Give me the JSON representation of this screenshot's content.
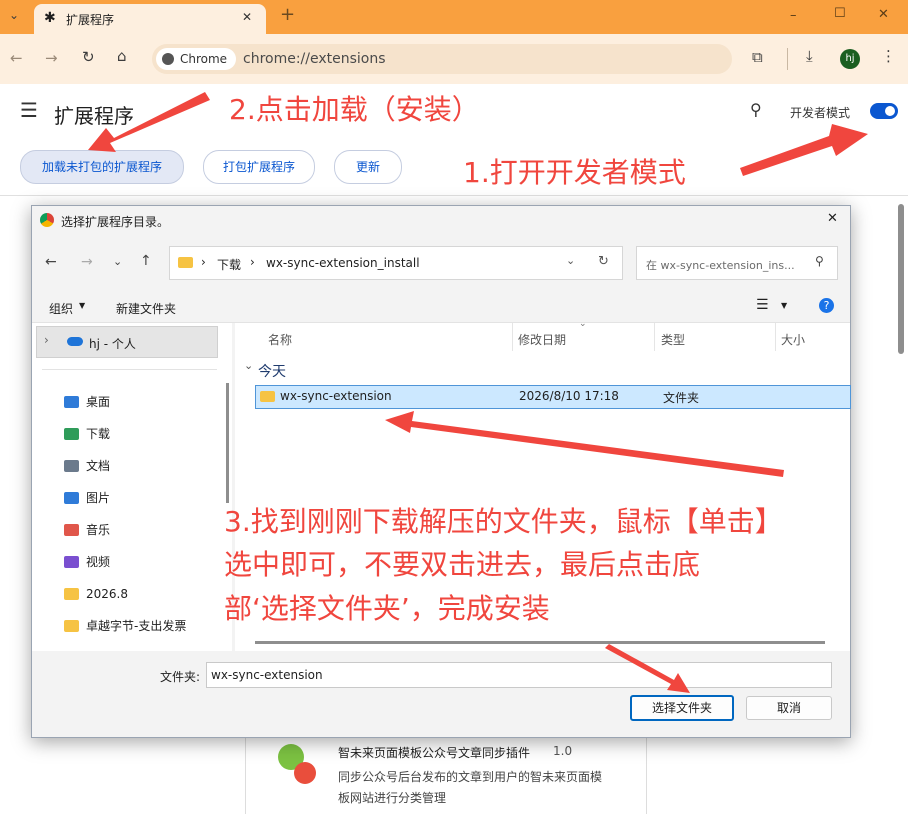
{
  "browser": {
    "tab_title": "扩展程序",
    "new_tab": "+",
    "chip_label": "Chrome",
    "url": "chrome://extensions",
    "profile_initials": "hj",
    "window_controls": [
      "–",
      "☐",
      "✕"
    ]
  },
  "extensions_page": {
    "title": "扩展程序",
    "dev_mode_label": "开发者模式",
    "buttons": {
      "load_unpacked": "加载未打包的扩展程序",
      "pack": "打包扩展程序",
      "update": "更新"
    },
    "card": {
      "name": "智未来页面模板公众号文章同步插件",
      "version": "1.0",
      "description_line1": "同步公众号后台发布的文章到用户的智未来页面模",
      "description_line2": "板网站进行分类管理"
    }
  },
  "dialog": {
    "title": "选择扩展程序目录。",
    "breadcrumb": [
      "下载",
      "wx-sync-extension_install"
    ],
    "search_placeholder": "在 wx-sync-extension_ins...",
    "organize": "组织",
    "new_folder": "新建文件夹",
    "nav_top": "hj - 个人",
    "nav_items": [
      {
        "label": "桌面",
        "icon": "desktop-icon",
        "color": "#2f7bd8"
      },
      {
        "label": "下载",
        "icon": "download-icon",
        "color": "#2f9c5a"
      },
      {
        "label": "文档",
        "icon": "document-icon",
        "color": "#6b7a8c"
      },
      {
        "label": "图片",
        "icon": "picture-icon",
        "color": "#2f7bd8"
      },
      {
        "label": "音乐",
        "icon": "music-icon",
        "color": "#e0564a"
      },
      {
        "label": "视频",
        "icon": "video-icon",
        "color": "#7a4fd0"
      },
      {
        "label": "2026.8",
        "icon": "folder-icon",
        "color": "#f6c343"
      },
      {
        "label": "卓越字节-支出发票",
        "icon": "folder-icon",
        "color": "#f6c343"
      }
    ],
    "columns": {
      "name": "名称",
      "modified": "修改日期",
      "type": "类型",
      "size": "大小"
    },
    "group_label": "今天",
    "file_row": {
      "name": "wx-sync-extension",
      "modified": "2026/8/10 17:18",
      "type": "文件夹"
    },
    "folder_label": "文件夹:",
    "folder_value": "wx-sync-extension",
    "select_button": "选择文件夹",
    "cancel_button": "取消"
  },
  "annotations": {
    "step1": "1.打开开发者模式",
    "step2": "2.点击加载（安装）",
    "step3_line1": "3.找到刚刚下载解压的文件夹，鼠标【单击】",
    "step3_line2": "选中即可，不要双击进去，最后点击底",
    "step3_line3": "部‘选择文件夹’，完成安装"
  },
  "colors": {
    "tabstrip": "#f9a03f",
    "toolbar": "#fdefdf",
    "accent": "#0b57d0",
    "annotation": "#f0463e"
  }
}
